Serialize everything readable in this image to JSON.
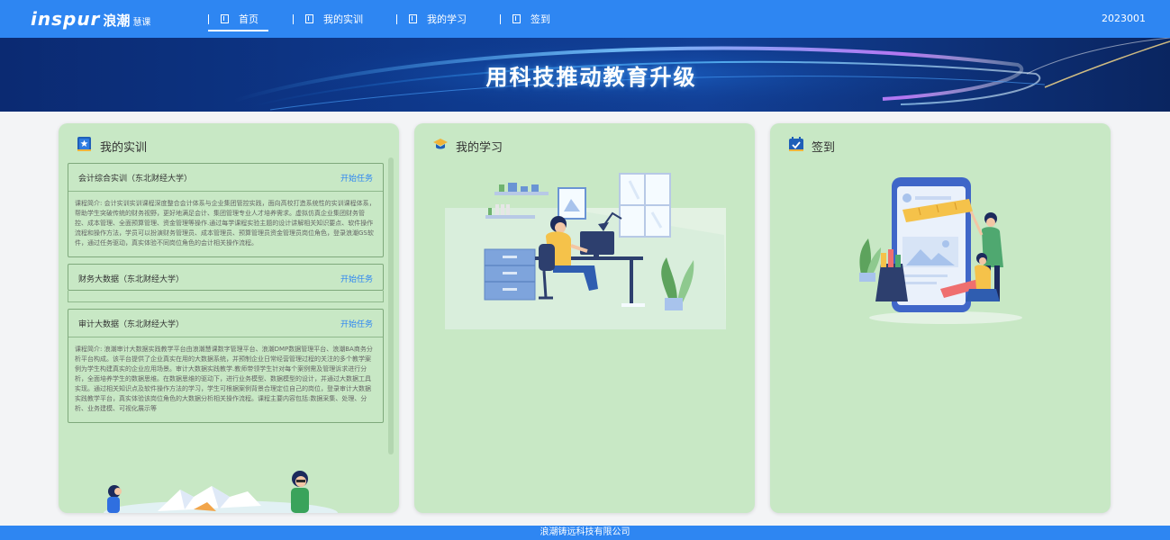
{
  "nav": {
    "logo_brand": "inspur",
    "logo_cn": "浪潮",
    "logo_sub": "慧课",
    "items": [
      {
        "label": "首页",
        "active": true
      },
      {
        "label": "我的实训",
        "active": false
      },
      {
        "label": "我的学习",
        "active": false
      },
      {
        "label": "签到",
        "active": false
      }
    ],
    "user_id": "2023001"
  },
  "banner": {
    "title": "用科技推动教育升级"
  },
  "cards": {
    "training": {
      "title": "我的实训",
      "icon": "star-book-icon",
      "tasks": [
        {
          "title": "会计综合实训（东北财经大学）",
          "action": "开始任务",
          "description": "课程简介: 会计实训实训课程深度整合会计体系与企业集团管控实践，面向高校打造系统性的实训课程体系，帮助学生突破传统的财务视野，更好地满足会计、集团管理专业人才培养需求。虚拟仿真企业集团财务管控、成本管理、全面预算管理、资金管理等操作.通过每学课程实验主题的设计讲解相关知识要点、软件操作流程和操作方法，学员可以扮演财务管理员、成本管理员、预算管理员资金管理员岗位角色，登录浪潮GS软件，通过任务驱动，真实体验不同岗位角色的会计相关操作流程。"
        },
        {
          "title": "财务大数据（东北财经大学）",
          "action": "开始任务",
          "description": ""
        },
        {
          "title": "审计大数据（东北财经大学）",
          "action": "开始任务",
          "description": "课程简介: 浪潮审计大数据实践教学平台由浪潮慧课数字管理平台、浪潮DMP数据管理平台、浪潮BA商务分析平台构成。该平台提供了企业真实在用的大数据系统，并预制企业日常经营管理过程的关注的多个教学案例为学生构建真实的企业应用场景。审计大数据实践教学.教师带领学生针对每个案例需及管理诉求进行分析，全面培养学生的数据思维。在数据思维的驱动下，进行业务模型、数据模型的设计，并通过大数据工具实现。通过相关知识点及软件操作方法的学习，学生可根据案例背景合理定位自己的岗位，登录审计大数据实践教学平台，真实体验该岗位角色的大数据分析相关操作流程。课程主要内容包括:数据采集、处理、分析、业务建模、可视化展示等"
        }
      ]
    },
    "learning": {
      "title": "我的学习",
      "icon": "graduation-cap-icon"
    },
    "checkin": {
      "title": "签到",
      "icon": "calendar-check-icon"
    }
  },
  "footer": {
    "text": "浪潮铸远科技有限公司"
  },
  "colors": {
    "primary": "#2e86f2",
    "card_bg": "#c8e8c5",
    "banner_bg": "#0e3a8e",
    "link": "#2e86f2"
  }
}
